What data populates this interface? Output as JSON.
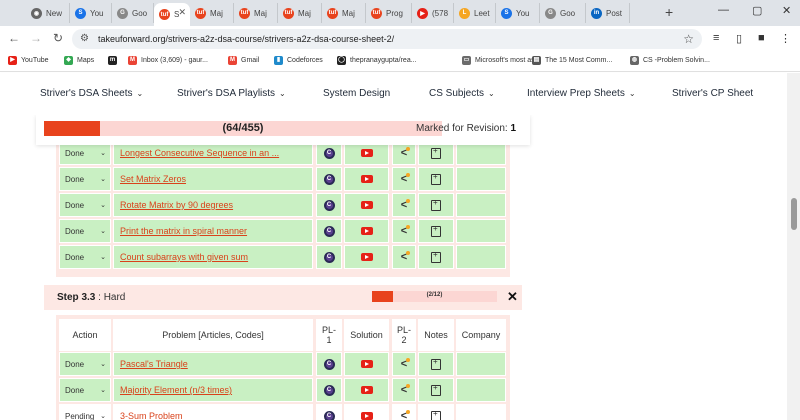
{
  "browser": {
    "tabs": [
      {
        "label": "New",
        "icon": "chrome-icon",
        "color": "#666666",
        "glyph": "◉"
      },
      {
        "label": "You",
        "icon": "s-icon",
        "color": "#1a73e8",
        "glyph": "S"
      },
      {
        "label": "Goo",
        "icon": "google-icon",
        "color": "#888888",
        "glyph": "G"
      },
      {
        "label": "S",
        "icon": "tuf-icon",
        "color": "#e8431d",
        "glyph": "tuf",
        "active": true
      },
      {
        "label": "Maj",
        "icon": "tuf-icon",
        "color": "#e8431d",
        "glyph": "tuf"
      },
      {
        "label": "Maj",
        "icon": "tuf-icon",
        "color": "#e8431d",
        "glyph": "tuf"
      },
      {
        "label": "Maj",
        "icon": "tuf-icon",
        "color": "#e8431d",
        "glyph": "tuf"
      },
      {
        "label": "Maj",
        "icon": "tuf-icon",
        "color": "#e8431d",
        "glyph": "tuf"
      },
      {
        "label": "Prog",
        "icon": "tuf-icon",
        "color": "#e8431d",
        "glyph": "tuf"
      },
      {
        "label": "(578",
        "icon": "youtube-icon",
        "color": "#e62117",
        "glyph": "▶"
      },
      {
        "label": "Leet",
        "icon": "leetcode-icon",
        "color": "#f5a623",
        "glyph": "L"
      },
      {
        "label": "You",
        "icon": "s-icon",
        "color": "#1a73e8",
        "glyph": "S"
      },
      {
        "label": "Goo",
        "icon": "google-icon",
        "color": "#888888",
        "glyph": "G"
      },
      {
        "label": "Post",
        "icon": "linkedin-icon",
        "color": "#0a66c2",
        "glyph": "in"
      }
    ],
    "url": "takeuforward.org/strivers-a2z-dsa-course/strivers-a2z-dsa-course-sheet-2/",
    "bookmarks": [
      {
        "label": "YouTube",
        "color": "#e62117",
        "glyph": "▶"
      },
      {
        "label": "Maps",
        "color": "#34a853",
        "glyph": "◆"
      },
      {
        "label": "",
        "color": "#222222",
        "glyph": "m"
      },
      {
        "label": "Inbox (3,609) - gaur...",
        "color": "#ea4335",
        "glyph": "M"
      },
      {
        "label": "Gmail",
        "color": "#ea4335",
        "glyph": "M"
      },
      {
        "label": "Codeforces",
        "color": "#1f8acb",
        "glyph": "▮"
      },
      {
        "label": "thepranaygupta/rea...",
        "color": "#222222",
        "glyph": "◯"
      },
      {
        "label": "Microsoft's most as...",
        "color": "#6b6b6b",
        "glyph": "▭"
      },
      {
        "label": "The 15 Most Comm...",
        "color": "#555555",
        "glyph": "▤"
      },
      {
        "label": "CS -Problem Solvin...",
        "color": "#666666",
        "glyph": "◍"
      }
    ]
  },
  "site_nav": [
    {
      "label": "Striver's DSA Sheets",
      "dropdown": true
    },
    {
      "label": "Striver's DSA Playlists",
      "dropdown": true
    },
    {
      "label": "System Design",
      "dropdown": false
    },
    {
      "label": "CS Subjects",
      "dropdown": true
    },
    {
      "label": "Interview Prep Sheets",
      "dropdown": true
    },
    {
      "label": "Striver's CP Sheet",
      "dropdown": false
    }
  ],
  "progress": {
    "text": "(64/455)",
    "fraction": 0.1407,
    "revision_label": "Marked for Revision:",
    "revision_count": "1"
  },
  "colors": {
    "accent": "#e8431d",
    "done_bg": "#c9f0c3",
    "link": "#d9421b",
    "section_bg": "#fde8e4"
  },
  "medium_problems": [
    {
      "status": "Done",
      "title": "Longest Consecutive Sequence in an ..."
    },
    {
      "status": "Done",
      "title": "Set Matrix Zeros"
    },
    {
      "status": "Done",
      "title": "Rotate Matrix by 90 degrees"
    },
    {
      "status": "Done",
      "title": "Print the matrix in spiral manner"
    },
    {
      "status": "Done",
      "title": "Count subarrays with given sum"
    }
  ],
  "step": {
    "title": "Step 3.3",
    "level": " : Hard",
    "count": "(2/12)",
    "fraction": 0.1667,
    "close": "✕"
  },
  "hard_table": {
    "headers": {
      "action": "Action",
      "problem": "Problem [Articles, Codes]",
      "pl1_a": "PL-",
      "pl1_b": "1",
      "solution": "Solution",
      "pl2_a": "PL-",
      "pl2_b": "2",
      "notes": "Notes",
      "company": "Company"
    },
    "rows": [
      {
        "status": "Done",
        "title": "Pascal's Triangle"
      },
      {
        "status": "Done",
        "title": "Majority Element (n/3 times)"
      },
      {
        "status": "Pending",
        "title": "3-Sum Problem"
      }
    ]
  }
}
